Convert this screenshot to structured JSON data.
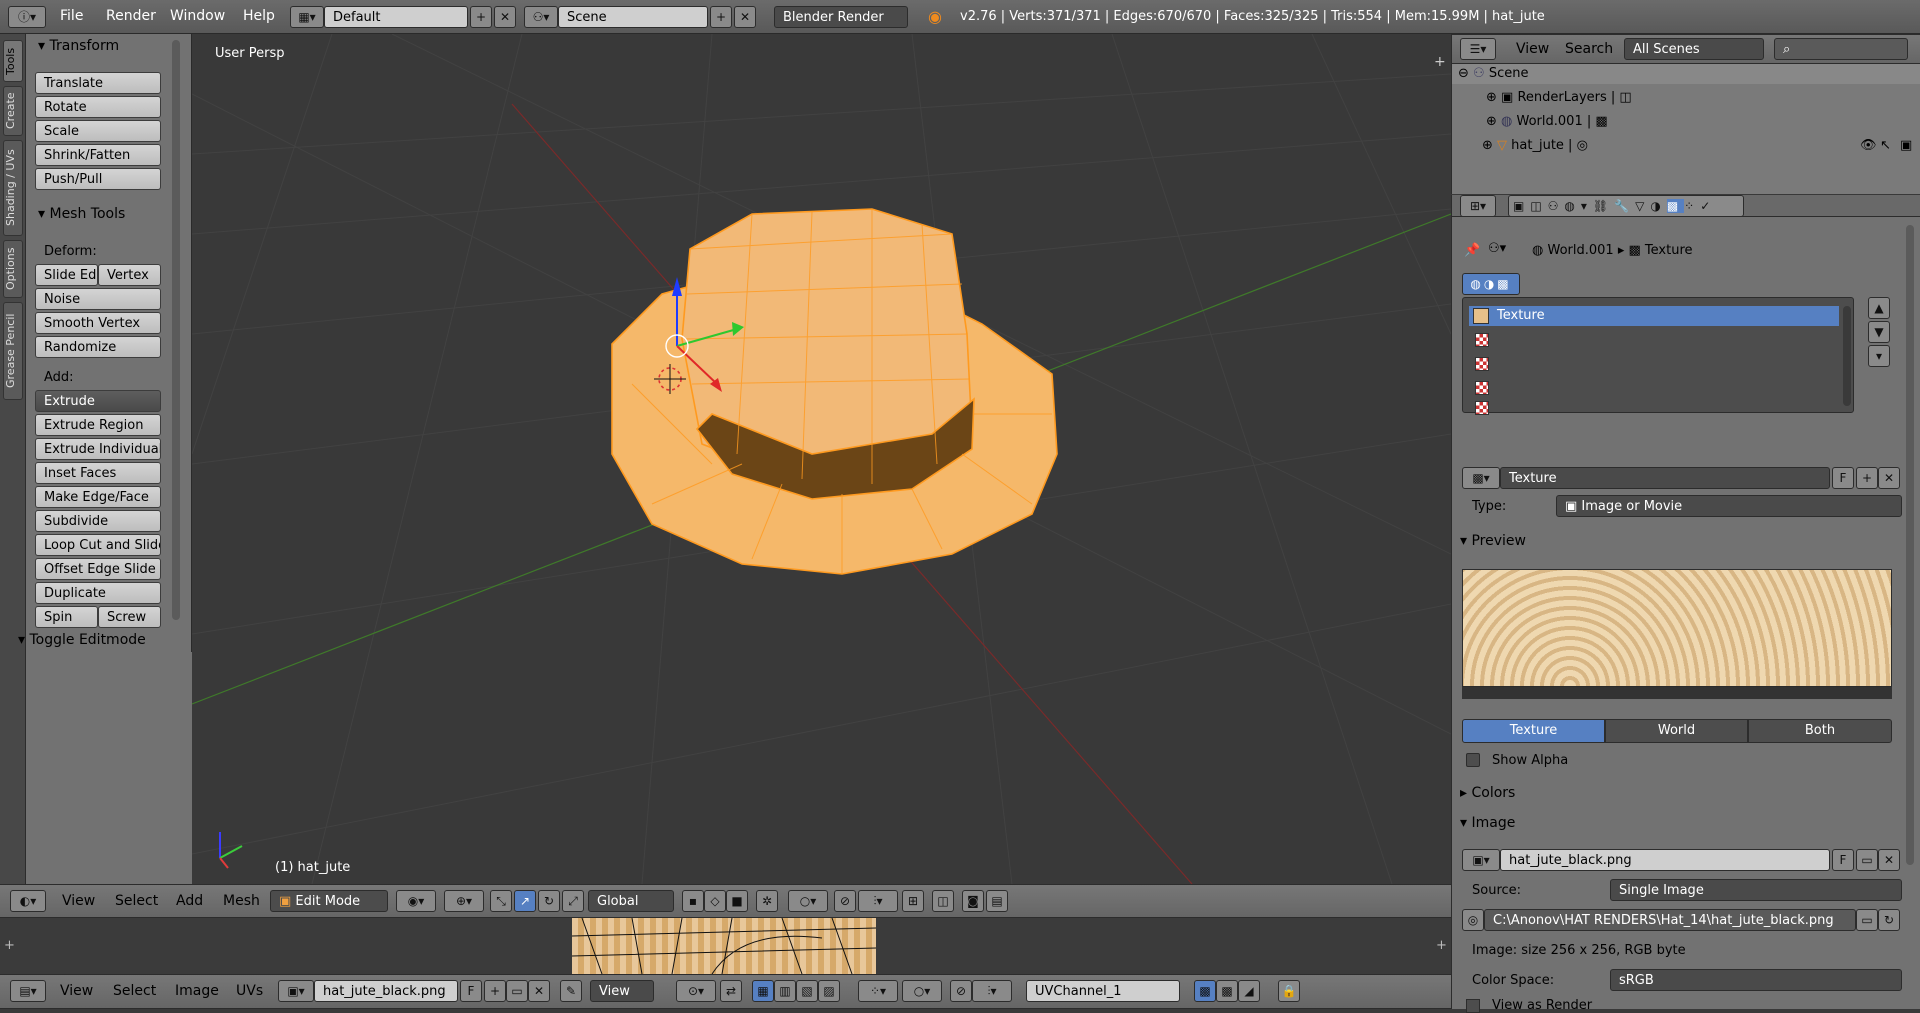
{
  "topbar": {
    "menus": [
      "File",
      "Render",
      "Window",
      "Help"
    ],
    "layout": "Default",
    "scene": "Scene",
    "engine": "Blender Render",
    "stats": "v2.76 | Verts:371/371 | Edges:670/670 | Faces:325/325 | Tris:554 | Mem:15.99M | hat_jute"
  },
  "vtabs": [
    "Tools",
    "Create",
    "Shading / UVs",
    "Options",
    "Grease Pencil"
  ],
  "toolshelf": {
    "transform_title": "Transform",
    "transform": [
      "Translate",
      "Rotate",
      "Scale",
      "Shrink/Fatten",
      "Push/Pull"
    ],
    "meshtools_title": "Mesh Tools",
    "deform_label": "Deform:",
    "slide_ed": "Slide Ed",
    "vertex": "Vertex",
    "deform": [
      "Noise",
      "Smooth Vertex",
      "Randomize"
    ],
    "add_label": "Add:",
    "extrude": "Extrude",
    "add": [
      "Extrude Region",
      "Extrude Individual",
      "Inset Faces",
      "Make Edge/Face",
      "Subdivide",
      "Loop Cut and Slide",
      "Offset Edge Slide",
      "Duplicate"
    ],
    "spin": "Spin",
    "screw": "Screw",
    "toggle_editmode": "Toggle Editmode"
  },
  "viewport": {
    "label": "User Persp",
    "object": "(1) hat_jute"
  },
  "view3d_header": {
    "view": "View",
    "select": "Select",
    "add": "Add",
    "mesh": "Mesh",
    "mode": "Edit Mode",
    "orientation": "Global"
  },
  "uv_header": {
    "view": "View",
    "select": "Select",
    "image": "Image",
    "uvs": "UVs",
    "image_name": "hat_jute_black.png",
    "f": "F",
    "view2": "View",
    "uvchannel": "UVChannel_1"
  },
  "outliner": {
    "view": "View",
    "search": "Search",
    "filter": "All Scenes",
    "tree": [
      {
        "label": "Scene"
      },
      {
        "label": "RenderLayers"
      },
      {
        "label": "World.001"
      },
      {
        "label": "hat_jute"
      }
    ]
  },
  "properties": {
    "breadcrumb_world": "World.001",
    "breadcrumb_texture": "Texture",
    "slots": [
      "Texture",
      "",
      "",
      "",
      ""
    ],
    "texture_name": "Texture",
    "f": "F",
    "type_label": "Type:",
    "type_value": "Image or Movie",
    "preview_title": "Preview",
    "preview_tabs": [
      "Texture",
      "World",
      "Both"
    ],
    "show_alpha": "Show Alpha",
    "colors_title": "Colors",
    "image_title": "Image",
    "image_name": "hat_jute_black.png",
    "source_label": "Source:",
    "source_value": "Single Image",
    "filepath": "C:\\Anonov\\HAT RENDERS\\Hat_14\\hat_jute_black.png",
    "image_info": "Image: size 256 x 256, RGB byte",
    "colorspace_label": "Color Space:",
    "colorspace_value": "sRGB",
    "view_as_render": "View as Render"
  },
  "colors": {
    "accent": "#5680c2",
    "mesh": "#f5a94a",
    "header": "#727272",
    "bg": "#393939"
  }
}
